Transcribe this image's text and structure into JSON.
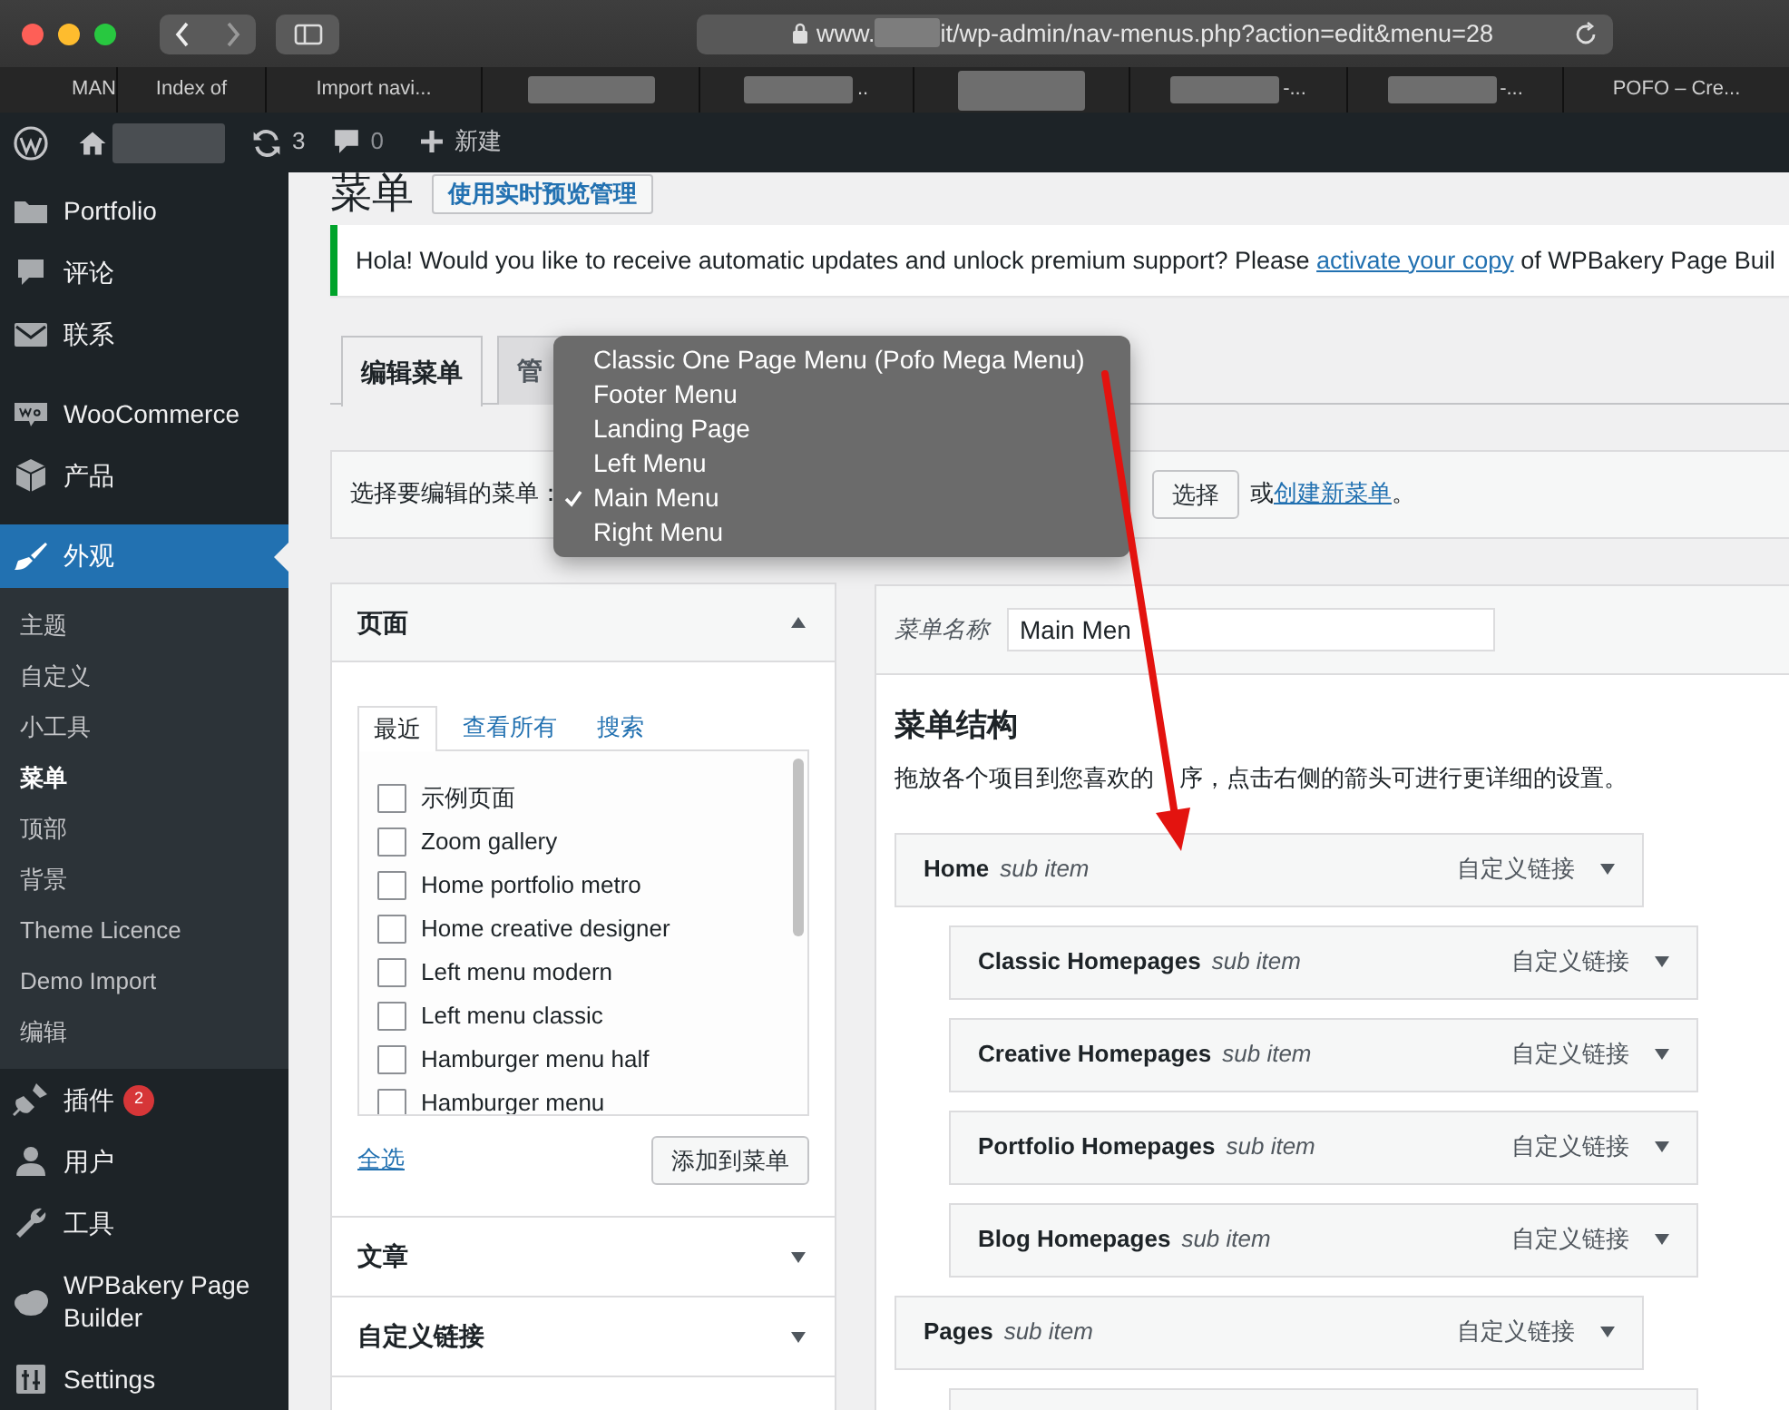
{
  "browser": {
    "url_start": "www.",
    "url_end": "it/wp-admin/nav-menus.php?action=edit&menu=28",
    "tabs": [
      {
        "label": "MAN",
        "redacted": false
      },
      {
        "label": "Index of",
        "redacted": false
      },
      {
        "label": "Import navi...",
        "redacted": false
      },
      {
        "redacted": true
      },
      {
        "label": "..",
        "redacted": true
      },
      {
        "redacted": true
      },
      {
        "label": "-...",
        "redacted": true
      },
      {
        "label": "-...",
        "redacted": true
      },
      {
        "label": "POFO – Cre...",
        "redacted": false
      }
    ]
  },
  "admin_bar": {
    "updates": "3",
    "comments": "0",
    "new_label": "新建"
  },
  "sidebar": {
    "groups": [
      {
        "items": [
          {
            "label": "Portfolio",
            "selected": false
          },
          {
            "label": "评论",
            "selected": false
          },
          {
            "label": "联系",
            "selected": false
          }
        ]
      },
      {
        "items": [
          {
            "label": "WooCommerce",
            "selected": false
          },
          {
            "label": "产品",
            "selected": false
          }
        ]
      },
      {
        "items": [
          {
            "label": "外观",
            "selected": true,
            "children": [
              {
                "label": "主题",
                "selected": false
              },
              {
                "label": "自定义",
                "selected": false
              },
              {
                "label": "小工具",
                "selected": false
              },
              {
                "label": "菜单",
                "selected": true
              },
              {
                "label": "顶部",
                "selected": false
              },
              {
                "label": "背景",
                "selected": false
              },
              {
                "label": "Theme Licence",
                "selected": false
              },
              {
                "label": "Demo Import",
                "selected": false
              },
              {
                "label": "编辑",
                "selected": false
              }
            ]
          },
          {
            "label": "插件",
            "selected": false,
            "badge": "2"
          },
          {
            "label": "用户",
            "selected": false
          },
          {
            "label": "工具",
            "selected": false
          },
          {
            "label": "WPBakery Page Builder",
            "selected": false
          },
          {
            "label": "Settings",
            "selected": false
          }
        ]
      }
    ]
  },
  "page": {
    "title": "菜单",
    "preview_button": "使用实时预览管理"
  },
  "notice": {
    "text_before": "Hola! Would you like to receive automatic updates and unlock premium support? Please ",
    "link": "activate your copy",
    "text_after": " of WPBakery Page Buil"
  },
  "tabs": [
    {
      "label": "编辑菜单",
      "selected": true
    },
    {
      "label": "管",
      "selected": false
    }
  ],
  "menu_select": {
    "label": "选择要编辑的菜单：",
    "button": "选择",
    "or_text": "或",
    "create_link": "创建新菜单",
    "end_text": "。"
  },
  "dropdown": {
    "options": [
      {
        "label": "Classic One Page Menu (Pofo Mega Menu)",
        "selected": false
      },
      {
        "label": "Footer Menu",
        "selected": false
      },
      {
        "label": "Landing Page",
        "selected": false
      },
      {
        "label": "Left Menu",
        "selected": false
      },
      {
        "label": "Main Menu",
        "selected": true
      },
      {
        "label": "Right Menu",
        "selected": false
      }
    ]
  },
  "add_items": {
    "panels": [
      {
        "title": "页面",
        "expanded": true
      },
      {
        "title": "文章",
        "expanded": false
      },
      {
        "title": "自定义链接",
        "expanded": false
      }
    ],
    "tabs": [
      {
        "label": "最近",
        "selected": true
      },
      {
        "label": "查看所有",
        "selected": false
      },
      {
        "label": "搜索",
        "selected": false
      }
    ],
    "items": [
      {
        "label": "示例页面",
        "checked": false
      },
      {
        "label": "Zoom gallery",
        "checked": false
      },
      {
        "label": "Home portfolio metro",
        "checked": false
      },
      {
        "label": "Home creative designer",
        "checked": false
      },
      {
        "label": "Left menu modern",
        "checked": false
      },
      {
        "label": "Left menu classic",
        "checked": false
      },
      {
        "label": "Hamburger menu half",
        "checked": false
      },
      {
        "label": "Hamburger menu",
        "checked": false
      }
    ],
    "select_all": "全选",
    "add_button": "添加到菜单"
  },
  "menu_edit": {
    "name_label": "菜单名称",
    "name_value": "Main Men",
    "structure_title": "菜单结构",
    "hint_start": "拖放各个项目到您喜欢的",
    "hint_end": "序，点击右侧的箭头可进行更详细的设置。",
    "items": [
      {
        "title": "Home",
        "subtitle": "sub item",
        "type": "自定义链接",
        "children": [
          {
            "title": "Classic Homepages",
            "subtitle": "sub item",
            "type": "自定义链接"
          },
          {
            "title": "Creative Homepages",
            "subtitle": "sub item",
            "type": "自定义链接"
          },
          {
            "title": "Portfolio Homepages",
            "subtitle": "sub item",
            "type": "自定义链接"
          },
          {
            "title": "Blog Homepages",
            "subtitle": "sub item",
            "type": "自定义链接"
          }
        ]
      },
      {
        "title": "Pages",
        "subtitle": "sub item",
        "type": "自定义链接"
      }
    ]
  }
}
